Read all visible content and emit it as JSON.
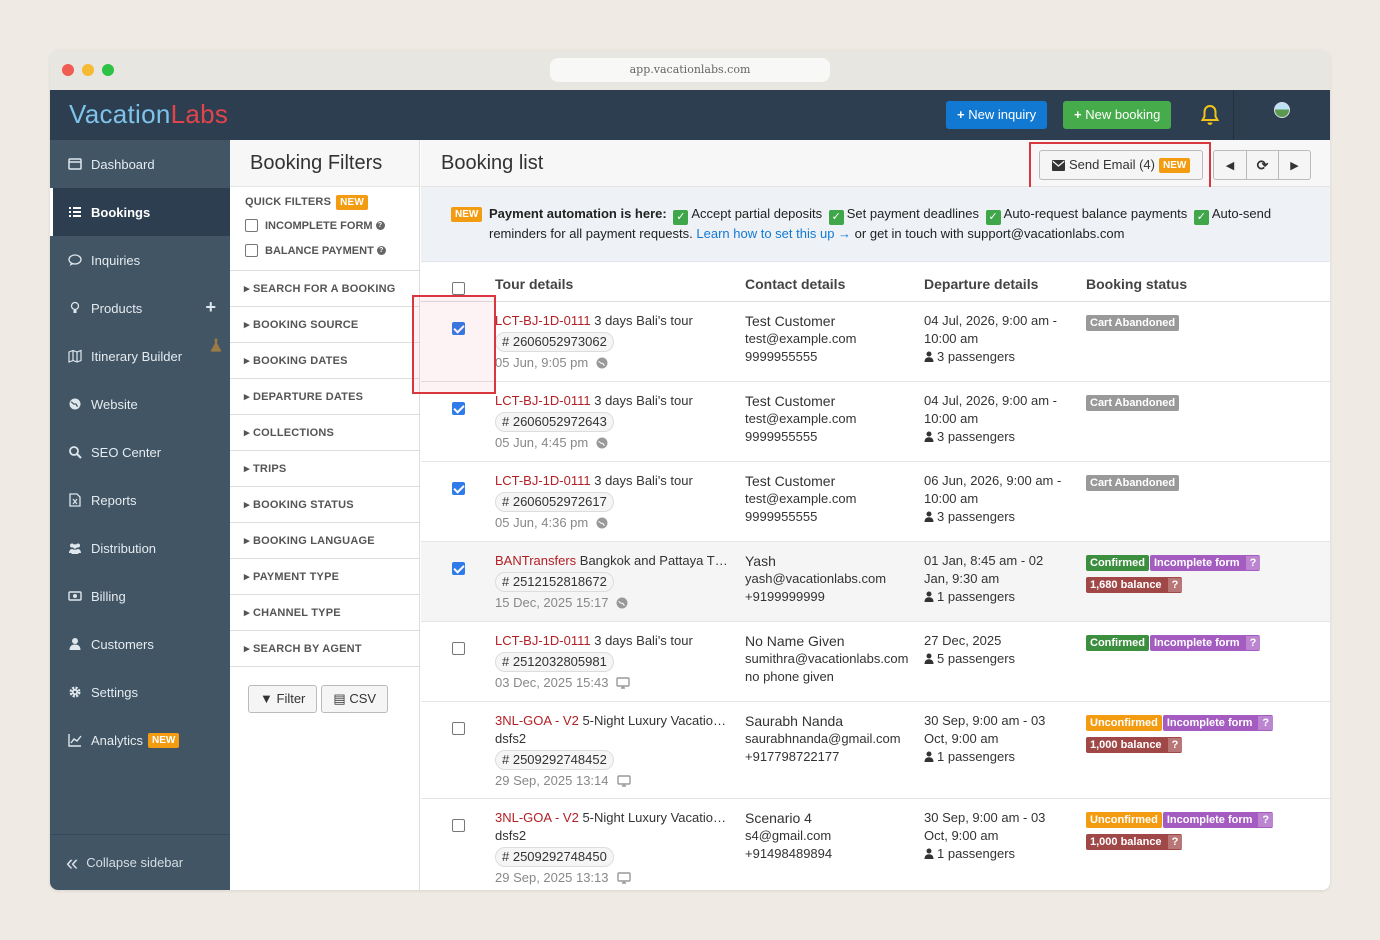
{
  "browser": {
    "url": "app.vacationlabs.com"
  },
  "brand": {
    "part1": "Vacation",
    "part2": "Labs"
  },
  "topbar": {
    "new_inquiry": "New inquiry",
    "new_booking": "New booking"
  },
  "sidebar": {
    "items": [
      {
        "label": "Dashboard",
        "icon": "dashboard-icon"
      },
      {
        "label": "Bookings",
        "icon": "list-icon",
        "active": true
      },
      {
        "label": "Inquiries",
        "icon": "chat-icon"
      },
      {
        "label": "Products",
        "icon": "lightbulb-icon"
      },
      {
        "label": "Itinerary Builder",
        "icon": "map-icon"
      },
      {
        "label": "Website",
        "icon": "globe-icon"
      },
      {
        "label": "SEO Center",
        "icon": "search-icon"
      },
      {
        "label": "Reports",
        "icon": "report-icon"
      },
      {
        "label": "Distribution",
        "icon": "users-icon"
      },
      {
        "label": "Billing",
        "icon": "money-icon"
      },
      {
        "label": "Customers",
        "icon": "user-icon"
      },
      {
        "label": "Settings",
        "icon": "gear-icon"
      },
      {
        "label": "Analytics",
        "icon": "chart-icon",
        "badge": "NEW"
      }
    ],
    "collapse": "Collapse sidebar"
  },
  "filters": {
    "title": "Booking Filters",
    "quick_title": "QUICK FILTERS",
    "quick_badge": "NEW",
    "quick": [
      "INCOMPLETE FORM",
      "BALANCE PAYMENT"
    ],
    "sections": [
      "SEARCH FOR A BOOKING",
      "BOOKING SOURCE",
      "BOOKING DATES",
      "DEPARTURE DATES",
      "COLLECTIONS",
      "TRIPS",
      "BOOKING STATUS",
      "BOOKING LANGUAGE",
      "PAYMENT TYPE",
      "CHANNEL TYPE",
      "SEARCH BY AGENT"
    ],
    "filter_btn": "Filter",
    "csv_btn": "CSV"
  },
  "main": {
    "title": "Booking list",
    "send_email": "Send Email (4)",
    "send_badge": "NEW",
    "banner": {
      "badge": "NEW",
      "lead": "Payment automation is here:",
      "f1": "Accept partial deposits",
      "f2": "Set payment deadlines",
      "f3": "Auto-request balance payments",
      "f4": "Auto-send reminders for all payment requests.",
      "link": "Learn how to set this up →",
      "tail": "or get in touch with support@vacationlabs.com"
    },
    "columns": [
      "Tour details",
      "Contact details",
      "Departure details",
      "Booking status"
    ]
  },
  "bookings": [
    {
      "checked": true,
      "code": "LCT-BJ-1D-0111",
      "tour": "3 days Bali's tour",
      "extra": "",
      "id": "# 2606052973062",
      "date": "05 Jun, 9:05 pm",
      "source": "globe-icon",
      "name": "Test Customer",
      "email": "test@example.com",
      "phone": "9999955555",
      "dep1": "04 Jul, 2026, 9:00 am -",
      "dep2": "10:00 am",
      "pax": "3 passengers",
      "statuses": [
        {
          "text": "Cart Abandoned",
          "color": "grey"
        }
      ]
    },
    {
      "checked": true,
      "code": "LCT-BJ-1D-0111",
      "tour": "3 days Bali's tour",
      "extra": "",
      "id": "# 2606052972643",
      "date": "05 Jun, 4:45 pm",
      "source": "globe-icon",
      "name": "Test Customer",
      "email": "test@example.com",
      "phone": "9999955555",
      "dep1": "04 Jul, 2026, 9:00 am -",
      "dep2": "10:00 am",
      "pax": "3 passengers",
      "statuses": [
        {
          "text": "Cart Abandoned",
          "color": "grey"
        }
      ]
    },
    {
      "checked": true,
      "code": "LCT-BJ-1D-0111",
      "tour": "3 days Bali's tour",
      "extra": "",
      "id": "# 2606052972617",
      "date": "05 Jun, 4:36 pm",
      "source": "globe-icon",
      "name": "Test Customer",
      "email": "test@example.com",
      "phone": "9999955555",
      "dep1": "06 Jun, 2026, 9:00 am -",
      "dep2": "10:00 am",
      "pax": "3 passengers",
      "statuses": [
        {
          "text": "Cart Abandoned",
          "color": "grey"
        }
      ]
    },
    {
      "checked": true,
      "code": "BANTransfers",
      "tour": "Bangkok and Pattaya T…",
      "extra": "",
      "id": "# 2512152818672",
      "date": "15 Dec, 2025 15:17",
      "source": "globe-icon",
      "name": "Yash",
      "email": "yash@vacationlabs.com",
      "phone": "+9199999999",
      "dep1": "01 Jan, 8:45 am - 02",
      "dep2": "Jan, 9:30 am",
      "pax": "1 passengers",
      "statuses": [
        {
          "text": "Confirmed",
          "color": "green"
        },
        {
          "text": "Incomplete form",
          "color": "purple",
          "q": "?"
        },
        {
          "text": "1,680 balance",
          "color": "red",
          "q": "?"
        }
      ]
    },
    {
      "checked": false,
      "code": "LCT-BJ-1D-0111",
      "tour": "3 days Bali's tour",
      "extra": "",
      "id": "# 2512032805981",
      "date": "03 Dec, 2025 15:43",
      "source": "monitor-icon",
      "name": "No Name Given",
      "email": "sumithra@vacationlabs.com",
      "phone": "no phone given",
      "dep1": "27 Dec, 2025",
      "dep2": "",
      "pax": "5 passengers",
      "statuses": [
        {
          "text": "Confirmed",
          "color": "green"
        },
        {
          "text": "Incomplete form",
          "color": "purple",
          "q": "?"
        }
      ]
    },
    {
      "checked": false,
      "code": "3NL-GOA - V2",
      "tour": "5-Night Luxury Vacatio…",
      "extra": "dsfs2",
      "id": "# 2509292748452",
      "date": "29 Sep, 2025 13:14",
      "source": "monitor-icon",
      "name": "Saurabh Nanda",
      "email": "saurabhnanda@gmail.com",
      "phone": "+917798722177",
      "dep1": "30 Sep, 9:00 am - 03",
      "dep2": "Oct, 9:00 am",
      "pax": "1 passengers",
      "statuses": [
        {
          "text": "Unconfirmed",
          "color": "orange"
        },
        {
          "text": "Incomplete form",
          "color": "purple",
          "q": "?"
        },
        {
          "text": "1,000 balance",
          "color": "red",
          "q": "?"
        }
      ]
    },
    {
      "checked": false,
      "code": "3NL-GOA - V2",
      "tour": "5-Night Luxury Vacatio…",
      "extra": "dsfs2",
      "id": "# 2509292748450",
      "date": "29 Sep, 2025 13:13",
      "source": "monitor-icon",
      "name": "Scenario 4",
      "email": "s4@gmail.com",
      "phone": "+91498489894",
      "dep1": "30 Sep, 9:00 am - 03",
      "dep2": "Oct, 9:00 am",
      "pax": "1 passengers",
      "statuses": [
        {
          "text": "Unconfirmed",
          "color": "orange"
        },
        {
          "text": "Incomplete form",
          "color": "purple",
          "q": "?"
        },
        {
          "text": "1,000 balance",
          "color": "red",
          "q": "?"
        }
      ]
    }
  ]
}
